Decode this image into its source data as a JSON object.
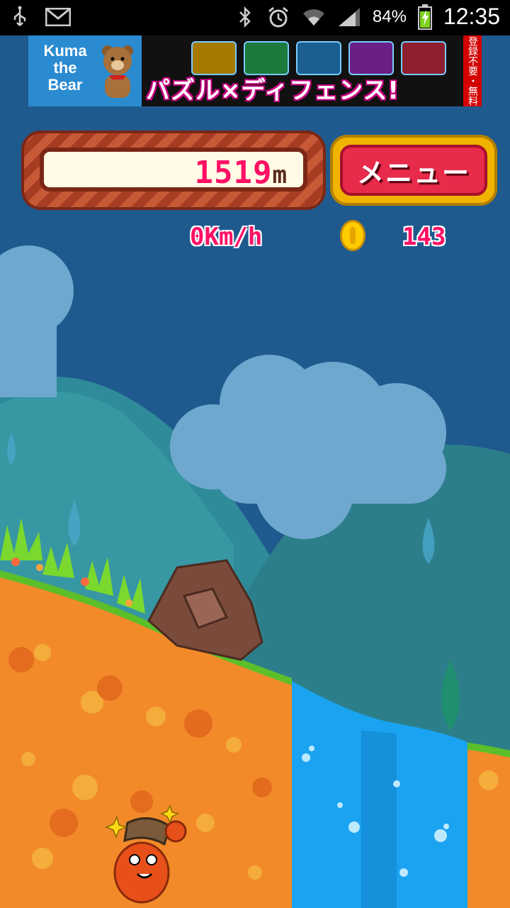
{
  "status_bar": {
    "battery_percent": "84%",
    "time": "12:35",
    "icons": [
      "usb-icon",
      "gmail-icon",
      "bluetooth-icon",
      "alarm-icon",
      "wifi-icon",
      "signal-icon",
      "battery-charging-icon"
    ]
  },
  "ad_banner": {
    "brand": "Kuma the Bear",
    "headline": "パズル×ディフェンス!",
    "badge": "登録不要・無料"
  },
  "hud": {
    "distance_value": "1519",
    "distance_unit": "m",
    "menu_label": "メニュー",
    "speed": "0Km/h",
    "coins": "143"
  },
  "colors": {
    "sky": "#1f5a8e",
    "hud_number": "#ff1065",
    "dirt": "#f28a2a",
    "water": "#1aa3f0",
    "menu_button": "#e82a4b"
  }
}
